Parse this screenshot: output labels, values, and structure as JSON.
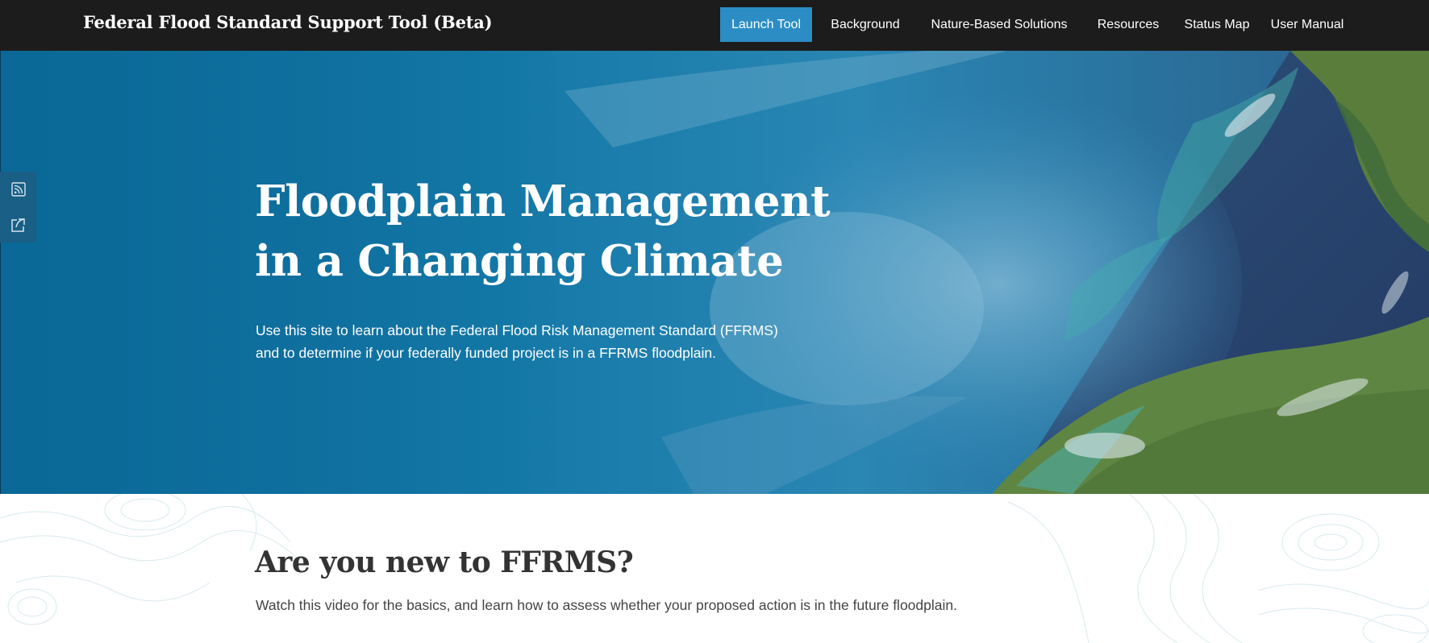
{
  "header": {
    "title": "Federal Flood Standard Support Tool (Beta)",
    "nav": [
      {
        "label": "Launch Tool",
        "active": true
      },
      {
        "label": "Background",
        "active": false
      },
      {
        "label": "Nature-Based Solutions",
        "active": false
      },
      {
        "label": "Resources",
        "active": false
      },
      {
        "label": "Status Map",
        "active": false
      },
      {
        "label": "User Manual",
        "active": false
      }
    ]
  },
  "hero": {
    "title_line1": "Floodplain Management",
    "title_line2": "in a Changing Climate",
    "text_line1": "Use this site to learn about the Federal Flood Risk Management Standard (FFRMS)",
    "text_line2": "and to determine if your federally funded project is in a FFRMS floodplain."
  },
  "side_widget": {
    "buttons": [
      {
        "icon": "rss-feed-icon"
      },
      {
        "icon": "share-icon"
      }
    ]
  },
  "intro": {
    "heading": "Are you new to FFRMS?",
    "text": "Watch this video for the basics, and learn how to assess whether your proposed action is in the future floodplain."
  },
  "colors": {
    "header_bg": "#1c1c1c",
    "accent": "#2b8dc4",
    "hero_blue": "#11729f",
    "side_widget_bg": "#1a5f86"
  }
}
